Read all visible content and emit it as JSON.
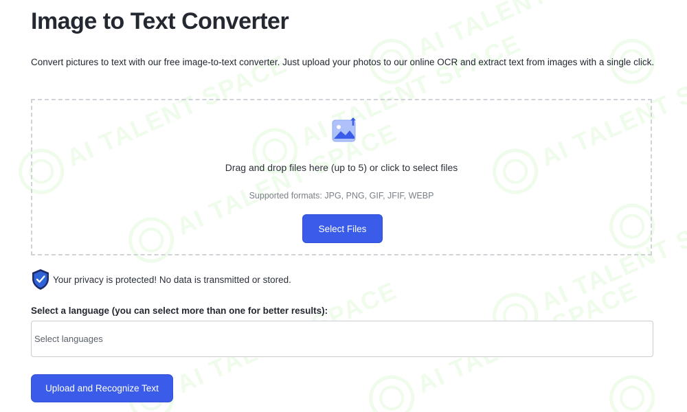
{
  "page": {
    "title": "Image to Text Converter",
    "description": "Convert pictures to text with our free image-to-text converter. Just upload your photos to our online OCR and extract text from images with a single click."
  },
  "dropzone": {
    "icon": "image-upload-icon",
    "instructions": "Drag and drop files here (up to 5) or click to select files",
    "formats": "Supported formats: JPG, PNG, GIF, JFIF, WEBP",
    "button_label": "Select Files"
  },
  "privacy": {
    "icon": "shield-check-icon",
    "text": "Your privacy is protected! No data is transmitted or stored."
  },
  "language": {
    "label": "Select a language (you can select more than one for better results):",
    "placeholder": "Select languages"
  },
  "actions": {
    "upload_label": "Upload and Recognize Text"
  },
  "watermark": {
    "text": "AI TALENT SPACE"
  },
  "colors": {
    "accent": "#3b5ce8",
    "watermark": "#96e678",
    "shield": "#2f63d8"
  }
}
